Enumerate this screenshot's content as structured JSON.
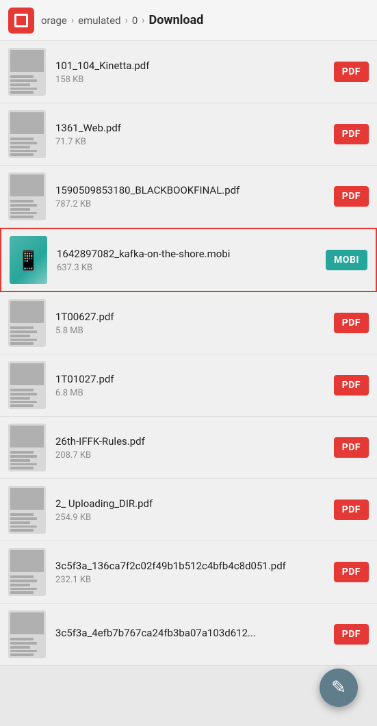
{
  "header": {
    "breadcrumb": [
      {
        "label": "orage",
        "active": false
      },
      {
        "label": "emulated",
        "active": false
      },
      {
        "label": "0",
        "active": false
      },
      {
        "label": "Download",
        "active": true
      }
    ]
  },
  "files": [
    {
      "name": "101_104_Kinetta.pdf",
      "size": "158 KB",
      "type": "PDF",
      "highlighted": false,
      "thumbClass": "thumb1"
    },
    {
      "name": "1361_Web.pdf",
      "size": "71.7 KB",
      "type": "PDF",
      "highlighted": false,
      "thumbClass": "thumb2"
    },
    {
      "name": "1590509853180_BLACKBOOKFINAL.pdf",
      "size": "787.2 KB",
      "type": "PDF",
      "highlighted": false,
      "thumbClass": "thumb3"
    },
    {
      "name": "1642897082_kafka-on-the-shore.mobi",
      "size": "637.3 KB",
      "type": "MOBI",
      "highlighted": true,
      "thumbClass": "thumb-mobi"
    },
    {
      "name": "1T00627.pdf",
      "size": "5.8 MB",
      "type": "PDF",
      "highlighted": false,
      "thumbClass": "thumb5"
    },
    {
      "name": "1T01027.pdf",
      "size": "6.8 MB",
      "type": "PDF",
      "highlighted": false,
      "thumbClass": "thumb6"
    },
    {
      "name": "26th-IFFK-Rules.pdf",
      "size": "208.7 KB",
      "type": "PDF",
      "highlighted": false,
      "thumbClass": "thumb7"
    },
    {
      "name": "2_ Uploading_DIR.pdf",
      "size": "254.9 KB",
      "type": "PDF",
      "highlighted": false,
      "thumbClass": "thumb8"
    },
    {
      "name": "3c5f3a_136ca7f2c02f49b1b512c4bfb4c8d051.pdf",
      "size": "232.1 KB",
      "type": "PDF",
      "highlighted": false,
      "thumbClass": "thumb9"
    },
    {
      "name": "3c5f3a_4efb7b767ca24fb3ba07a103d612...",
      "size": "",
      "type": "PDF",
      "highlighted": false,
      "thumbClass": "thumb1"
    }
  ],
  "fab": {
    "icon": "✎",
    "label": "Edit"
  },
  "badges": {
    "PDF": "PDF",
    "MOBI": "MOBI"
  }
}
